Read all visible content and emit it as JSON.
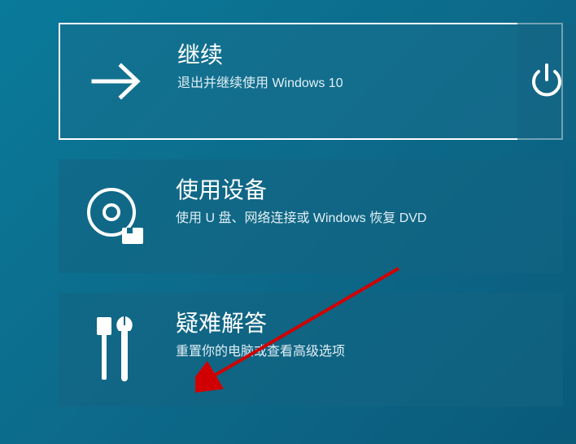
{
  "tiles": {
    "continue": {
      "title": "继续",
      "desc": "退出并继续使用 Windows 10"
    },
    "device": {
      "title": "使用设备",
      "desc": "使用 U 盘、网络连接或 Windows 恢复 DVD"
    },
    "troubleshoot": {
      "title": "疑难解答",
      "desc": "重置你的电脑或查看高级选项"
    }
  }
}
